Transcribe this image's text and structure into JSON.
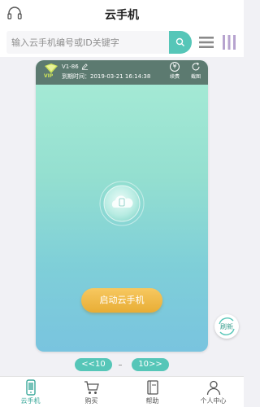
{
  "header": {
    "title": "云手机",
    "support_icon": "headset-icon"
  },
  "search": {
    "placeholder": "输入云手机编号或ID关键字",
    "button_icon": "search-icon"
  },
  "view_toggles": [
    "list-view-icon",
    "grid-view-icon"
  ],
  "device": {
    "vip": "VIP",
    "name": "V1-86",
    "expire": "到期时间：2019-03-21 16:14:38",
    "renew_label": "续费",
    "renew_icon": "yen-icon",
    "screenshot_label": "截图",
    "screenshot_icon": "refresh-icon",
    "start_button": "启动云手机"
  },
  "refresh_fab": "刷新",
  "pager": {
    "prev": "<<10",
    "next": "10>>"
  },
  "nav": {
    "items": [
      {
        "label": "云手机",
        "icon": "phone-icon",
        "active": true
      },
      {
        "label": "购买",
        "icon": "cart-icon",
        "active": false
      },
      {
        "label": "帮助",
        "icon": "book-icon",
        "active": false
      },
      {
        "label": "个人中心",
        "icon": "user-icon",
        "active": false
      }
    ]
  },
  "colors": {
    "accent": "#56c6b8",
    "card_top": "#5c7a70",
    "start_button": "#f0b948"
  }
}
